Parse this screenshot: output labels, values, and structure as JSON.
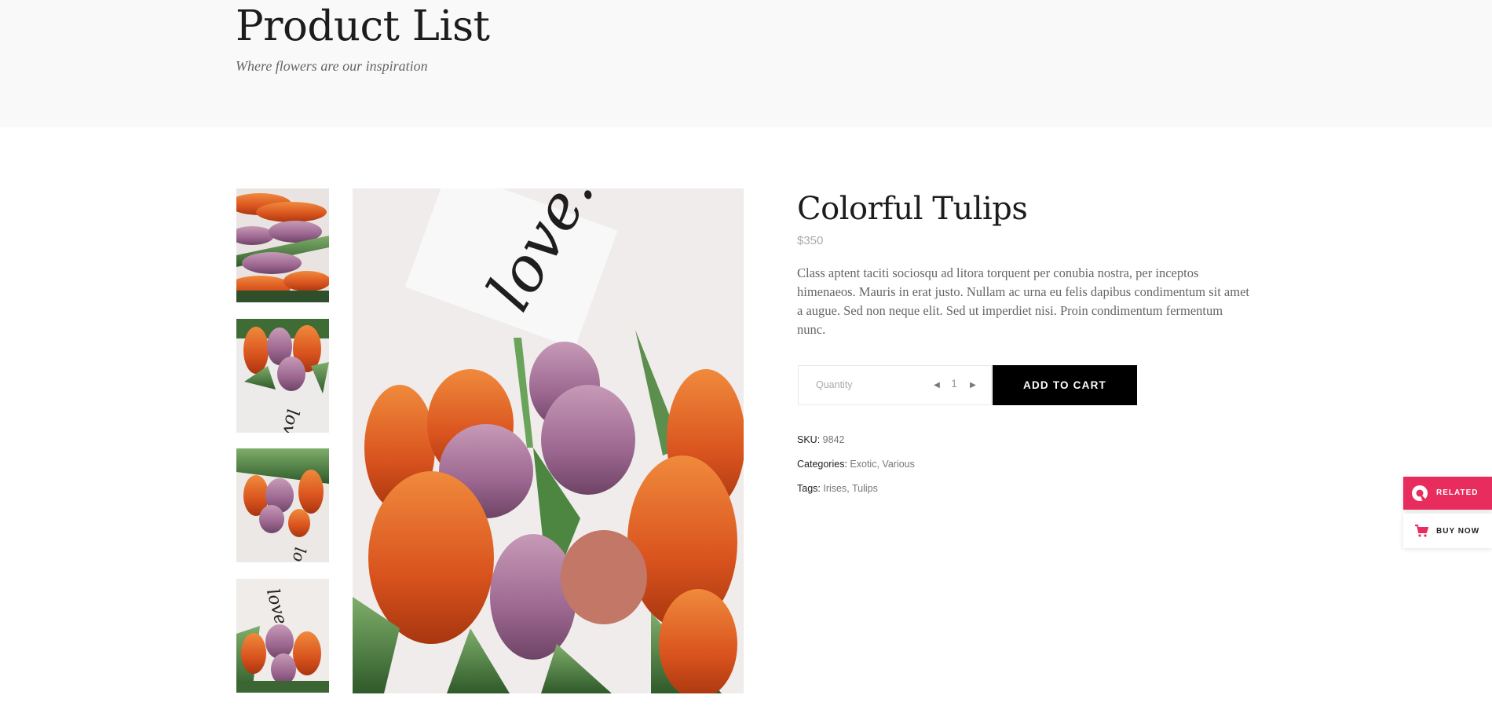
{
  "header": {
    "title": "Product List",
    "subtitle": "Where flowers are our inspiration"
  },
  "gallery": {
    "thumbnails": [
      {
        "icon": "tulips-photo-thumbnail-1"
      },
      {
        "icon": "tulips-photo-thumbnail-2"
      },
      {
        "icon": "tulips-photo-thumbnail-3"
      },
      {
        "icon": "tulips-photo-thumbnail-4"
      }
    ],
    "main_image": {
      "icon": "tulips-love-card-photo",
      "card_text": "love."
    }
  },
  "product": {
    "title": "Colorful Tulips",
    "price": "$350",
    "description": "Class aptent taciti sociosqu ad litora torquent per conubia nostra, per inceptos himenaeos. Mauris in erat justo. Nullam ac urna eu felis dapibus condimentum sit amet a augue. Sed non neque elit. Sed ut imperdiet nisi. Proin condimentum fermentum nunc.",
    "quantity_label": "Quantity",
    "quantity_value": "1",
    "add_to_cart": "ADD TO CART",
    "sku_label": "SKU:",
    "sku_value": "9842",
    "categories_label": "Categories:",
    "categories": [
      "Exotic",
      "Various"
    ],
    "tags_label": "Tags:",
    "tags": [
      "Irises",
      "Tulips"
    ],
    "separator": ", "
  },
  "side_panel": {
    "related_label": "RELATED",
    "buy_now_label": "BUY NOW",
    "accent_color": "#e82c5e"
  }
}
